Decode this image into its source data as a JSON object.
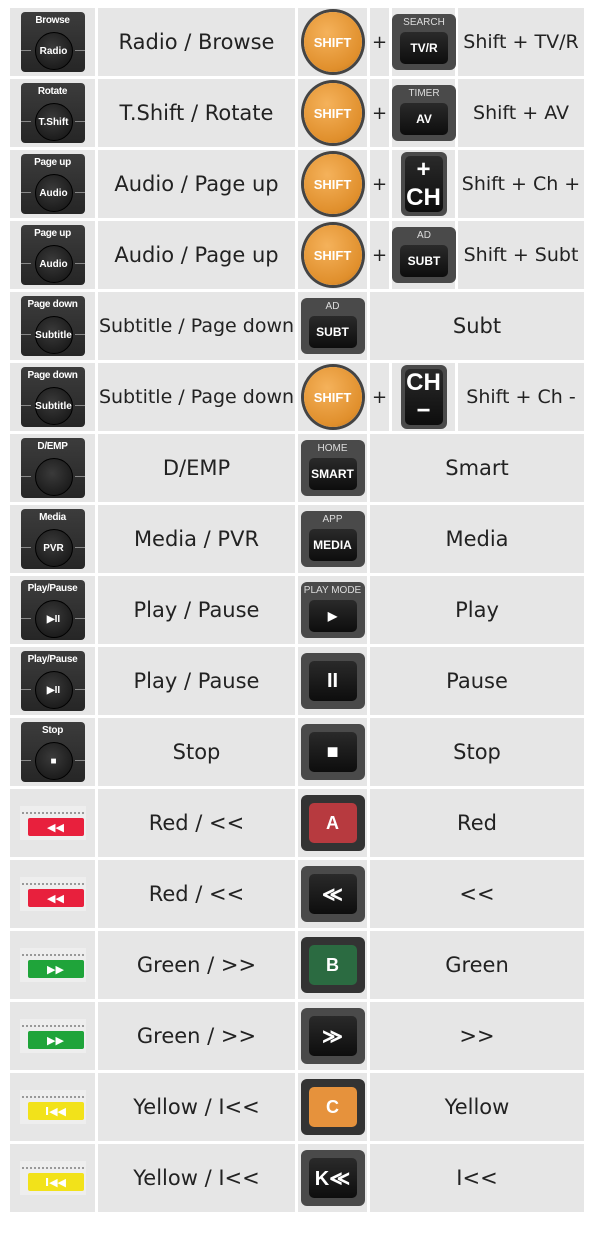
{
  "rows": [
    {
      "old_top": "Browse",
      "old_btn": "Radio",
      "left_text": "Radio / Browse",
      "kind": "combo",
      "new_top": "SEARCH",
      "new_key": "TV/R",
      "right_text": "Shift + TV/R"
    },
    {
      "old_top": "Rotate",
      "old_btn": "T.Shift",
      "left_text": "T.Shift / Rotate",
      "kind": "combo",
      "new_top": "TIMER",
      "new_key": "AV",
      "right_text": "Shift + AV"
    },
    {
      "old_top": "Page up",
      "old_btn": "Audio",
      "left_text": "Audio / Page up",
      "kind": "combo",
      "new_top": "",
      "new_key": "+ CH",
      "right_text": "Shift + Ch +"
    },
    {
      "old_top": "Page up",
      "old_btn": "Audio",
      "left_text": "Audio / Page up",
      "kind": "combo",
      "new_top": "AD",
      "new_key": "SUBT",
      "right_text": "Shift + Subt"
    },
    {
      "old_top": "Page down",
      "old_btn": "Subtitle",
      "left_text": "Subtitle / Page down",
      "kind": "single",
      "new_top": "AD",
      "new_key": "SUBT",
      "right_text": "Subt"
    },
    {
      "old_top": "Page down",
      "old_btn": "Subtitle",
      "left_text": "Subtitle / Page down",
      "kind": "combo",
      "new_top": "",
      "new_key": "CH −",
      "right_text": "Shift + Ch -"
    },
    {
      "old_top": "D/EMP",
      "old_btn": "",
      "left_text": "D/EMP",
      "kind": "single",
      "new_top": "HOME",
      "new_key": "SMART",
      "right_text": "Smart"
    },
    {
      "old_top": "Media",
      "old_btn": "PVR",
      "left_text": "Media / PVR",
      "kind": "single",
      "new_top": "APP",
      "new_key": "MEDIA",
      "right_text": "Media"
    },
    {
      "old_top": "Play/Pause",
      "old_btn": "▶II",
      "left_text": "Play / Pause",
      "kind": "single",
      "new_top": "PLAY MODE",
      "new_key": "▶",
      "right_text": "Play"
    },
    {
      "old_top": "Play/Pause",
      "old_btn": "▶II",
      "left_text": "Play / Pause",
      "kind": "single",
      "new_top": "",
      "new_key": "II",
      "right_text": "Pause"
    },
    {
      "old_top": "Stop",
      "old_btn": "■",
      "left_text": "Stop",
      "kind": "single",
      "new_top": "",
      "new_key": "■",
      "right_text": "Stop"
    },
    {
      "color": "#e8203d",
      "color_glyph": "◀◀",
      "left_text": "Red / <<",
      "kind": "single",
      "new_top": "",
      "new_key": "A",
      "new_color": "#b73a3f",
      "right_text": "Red"
    },
    {
      "color": "#e8203d",
      "color_glyph": "◀◀",
      "left_text": "Red / <<",
      "kind": "single",
      "new_top": "",
      "new_key": "≪",
      "right_text": "<<"
    },
    {
      "color": "#1fa43a",
      "color_glyph": "▶▶",
      "left_text": "Green / >>",
      "kind": "single",
      "new_top": "",
      "new_key": "B",
      "new_color": "#2b6b41",
      "right_text": "Green"
    },
    {
      "color": "#1fa43a",
      "color_glyph": "▶▶",
      "left_text": "Green / >>",
      "kind": "single",
      "new_top": "",
      "new_key": "≫",
      "right_text": ">>"
    },
    {
      "color": "#f2e21a",
      "color_glyph": "I◀◀",
      "left_text": "Yellow / I<<",
      "kind": "single",
      "new_top": "",
      "new_key": "C",
      "new_color": "#e6923c",
      "right_text": "Yellow"
    },
    {
      "color": "#f2e21a",
      "color_glyph": "I◀◀",
      "left_text": "Yellow / I<<",
      "kind": "single",
      "new_top": "",
      "new_key": "K≪",
      "right_text": "I<<"
    }
  ],
  "shift_label": "SHIFT",
  "plus_sign": "+"
}
